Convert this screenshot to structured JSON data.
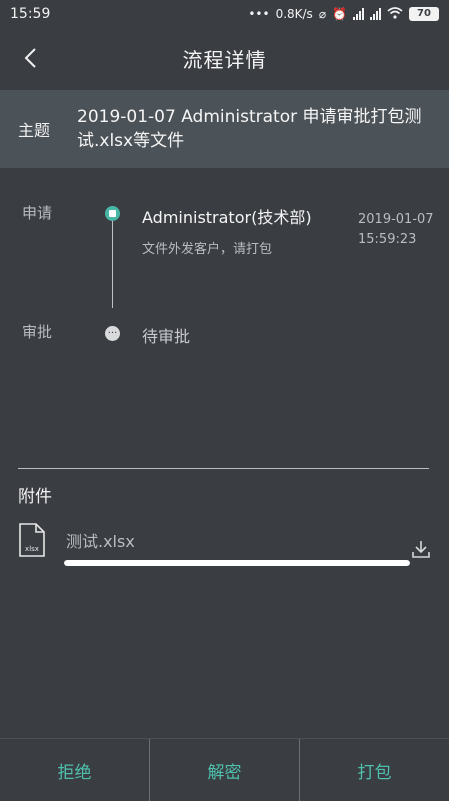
{
  "status_bar": {
    "time": "15:59",
    "network_speed": "0.8K/s",
    "battery": "70",
    "icons": [
      "dots-icon",
      "mute-icon",
      "alarm-icon",
      "signal-icon",
      "signal-icon",
      "wifi-icon",
      "battery-icon"
    ]
  },
  "header": {
    "title": "流程详情",
    "back_icon": "back-chevron-icon"
  },
  "subject": {
    "label": "主题",
    "text": "2019-01-07 Administrator 申请审批打包测试.xlsx等文件"
  },
  "timeline": {
    "apply": {
      "label": "申请",
      "name": "Administrator(技术部)",
      "note": "文件外发客户，请打包",
      "date": "2019-01-07",
      "time": "15:59:23"
    },
    "approve": {
      "label": "审批",
      "status": "待审批"
    }
  },
  "attachments": {
    "title": "附件",
    "file": {
      "icon_text": "xlsx",
      "name": "测试.xlsx",
      "progress": 1.0
    }
  },
  "actions": {
    "reject": "拒绝",
    "decrypt": "解密",
    "package": "打包"
  },
  "colors": {
    "background": "#3a3d42",
    "accent": "#4fc0ad",
    "subject_bar": "#4b5258"
  }
}
